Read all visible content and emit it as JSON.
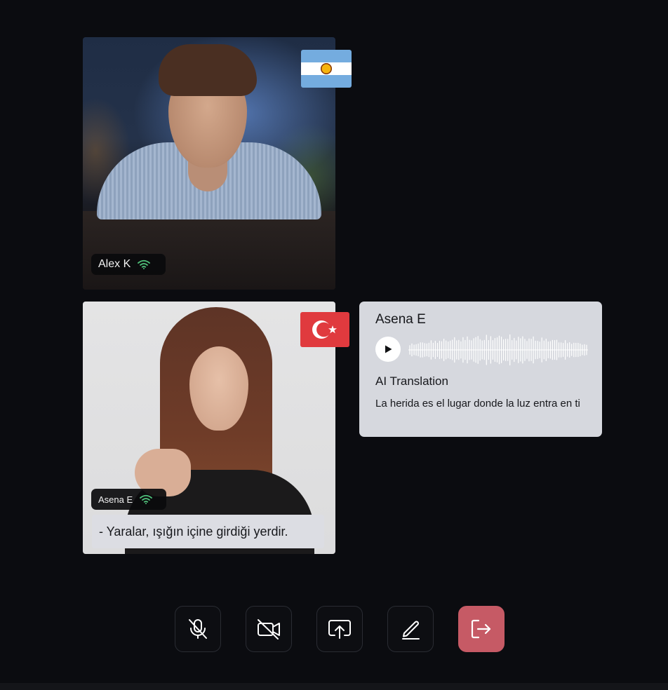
{
  "participants": {
    "alex": {
      "name": "Alex K",
      "flag": "argentina-flag-icon",
      "connection": "wifi-icon"
    },
    "asena": {
      "name": "Asena E",
      "flag": "turkey-flag-icon",
      "connection": "wifi-icon",
      "live_caption": "- Yaralar, ışığın içine girdiği yerdir."
    }
  },
  "translation_card": {
    "speaker": "Asena E",
    "audio_control": "play-icon",
    "heading": "AI Translation",
    "text": "La herida es el lugar donde la luz entra en ti"
  },
  "controls": [
    {
      "name": "mute-mic",
      "icon": "mic-off-icon"
    },
    {
      "name": "camera-off",
      "icon": "video-off-icon"
    },
    {
      "name": "share-screen",
      "icon": "screen-share-icon"
    },
    {
      "name": "draw",
      "icon": "pen-icon"
    },
    {
      "name": "leave-call",
      "icon": "exit-icon",
      "color": "#c65a65"
    }
  ],
  "colors": {
    "background": "#0b0c10",
    "card": "#d6d8de",
    "leave": "#c65a65",
    "wifi": "#4fc07a",
    "turkey_red": "#e03a3e",
    "argentina_blue": "#74acdf"
  }
}
